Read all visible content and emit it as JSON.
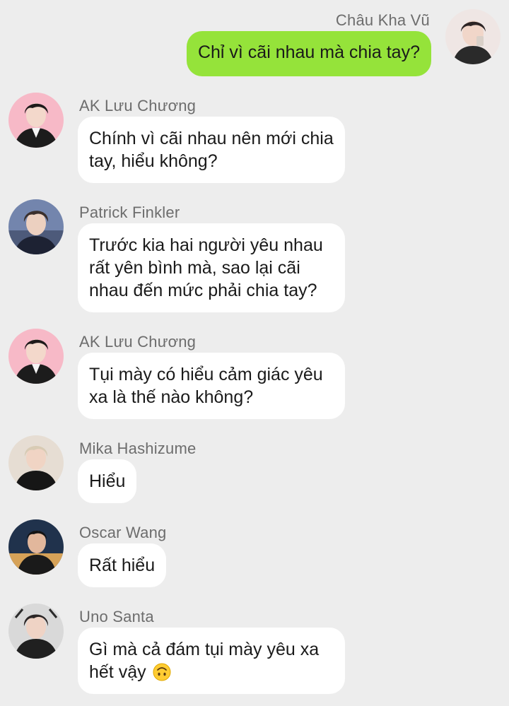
{
  "conversation": {
    "messages": [
      {
        "sender": "Châu Kha Vũ",
        "text": "Chỉ vì cãi nhau mà chia tay?",
        "outgoing": true,
        "avatar_colors": [
          "#f3e8e8",
          "#2b2b2b"
        ]
      },
      {
        "sender": "AK Lưu Chương",
        "text": "Chính vì cãi nhau nên mới chia tay, hiểu không?",
        "outgoing": false,
        "avatar_colors": [
          "#f6b7c6",
          "#1c1c1c"
        ]
      },
      {
        "sender": "Patrick Finkler",
        "text": "Trước kia hai người yêu nhau rất yên bình mà, sao lại cãi nhau đến mức phải chia tay?",
        "outgoing": false,
        "avatar_colors": [
          "#6d7fa8",
          "#1d2233"
        ]
      },
      {
        "sender": "AK Lưu Chương",
        "text": "Tụi mày có hiểu cảm giác yêu xa là thế nào không?",
        "outgoing": false,
        "avatar_colors": [
          "#f6b7c6",
          "#1c1c1c"
        ]
      },
      {
        "sender": "Mika Hashizume",
        "text": "Hiểu",
        "outgoing": false,
        "avatar_colors": [
          "#e4dcd2",
          "#161616"
        ]
      },
      {
        "sender": "Oscar Wang",
        "text": "Rất hiểu",
        "outgoing": false,
        "avatar_colors": [
          "#d9a75a",
          "#1a2a3f"
        ]
      },
      {
        "sender": "Uno Santa",
        "text": "Gì mà cả đám tụi mày yêu xa hết vậy",
        "emoji": "upside-down-face-emoji",
        "outgoing": false,
        "avatar_colors": [
          "#d8d8d8",
          "#202020"
        ]
      }
    ]
  },
  "colors": {
    "background": "#ededed",
    "outgoing_bubble": "#95e33a",
    "incoming_bubble": "#ffffff",
    "name_text": "#6d6d6d",
    "message_text": "#1a1a1a"
  }
}
